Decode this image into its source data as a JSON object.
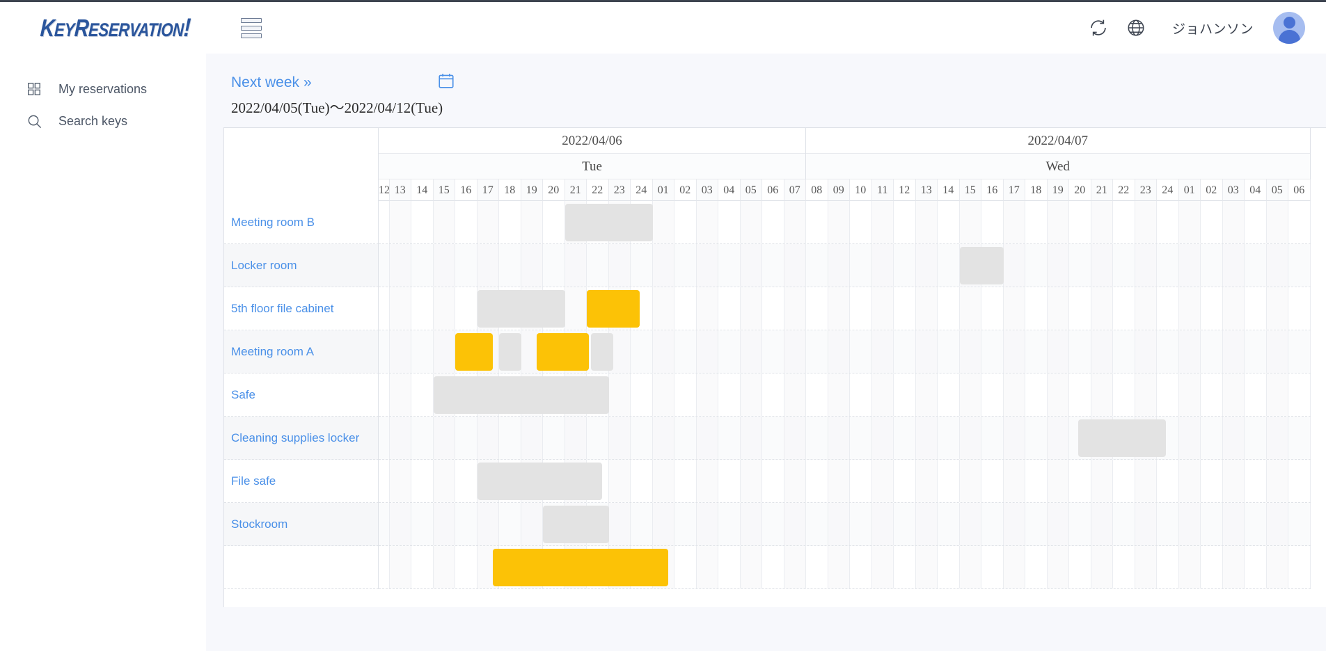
{
  "app": {
    "logo_prefix": "K",
    "logo_word1": "EY",
    "logo_r": "R",
    "logo_word2": "ESERVATION",
    "logo_bang": "!",
    "logo_full": "KeyReservation!",
    "accent_blue": "#4a90e8",
    "reserved_color": "#fcc206",
    "busy_color": "#e3e3e3"
  },
  "header": {
    "menu_icon": "hamburger-icon",
    "refresh_icon": "refresh-icon",
    "language_icon": "globe-icon",
    "user_name": "ジョハンソン",
    "avatar_icon": "user-avatar-icon"
  },
  "sidebar": {
    "items": [
      {
        "label": "My reservations",
        "icon": "grid-icon"
      },
      {
        "label": "Search keys",
        "icon": "search-icon"
      }
    ]
  },
  "toolbar": {
    "next_week_label": "Next week",
    "next_week_chevron": "»",
    "calendar_icon": "calendar-icon",
    "date_range": "2022/04/05(Tue)～2022/04/12(Tue)"
  },
  "schedule": {
    "days": [
      {
        "date": "2022/04/06",
        "dow": "Tue",
        "hours": [
          "12",
          "13",
          "14",
          "15",
          "16",
          "17",
          "18",
          "19",
          "20",
          "21",
          "22",
          "23",
          "24",
          "01",
          "02",
          "03",
          "04",
          "05",
          "06",
          "07"
        ],
        "first_hour_clipped": true
      },
      {
        "date": "2022/04/07",
        "dow": "Wed",
        "hours": [
          "08",
          "09",
          "10",
          "11",
          "12",
          "13",
          "14",
          "15",
          "16",
          "17",
          "18",
          "19",
          "20",
          "21",
          "22",
          "23",
          "24",
          "01",
          "02",
          "03",
          "04",
          "05",
          "06"
        ],
        "first_hour_clipped": false
      }
    ],
    "rows": [
      {
        "label": "Meeting room B",
        "blocks": [
          {
            "start": 9,
            "span": 4,
            "type": "gray"
          }
        ]
      },
      {
        "label": "Locker room",
        "blocks": [
          {
            "start": 27,
            "span": 2,
            "type": "gray"
          }
        ]
      },
      {
        "label": "5th floor file cabinet",
        "blocks": [
          {
            "start": 5,
            "span": 4,
            "type": "gray"
          },
          {
            "start": 10,
            "span": 2.4,
            "type": "yellow"
          }
        ]
      },
      {
        "label": "Meeting room A",
        "blocks": [
          {
            "start": 4,
            "span": 1.7,
            "type": "yellow"
          },
          {
            "start": 6,
            "span": 1,
            "type": "gray"
          },
          {
            "start": 7.7,
            "span": 2.4,
            "type": "yellow"
          },
          {
            "start": 10.2,
            "span": 1,
            "type": "gray"
          }
        ]
      },
      {
        "label": "Safe",
        "blocks": [
          {
            "start": 3,
            "span": 8,
            "type": "gray"
          }
        ]
      },
      {
        "label": "Cleaning supplies locker",
        "blocks": [
          {
            "start": 32.4,
            "span": 4,
            "type": "gray"
          }
        ]
      },
      {
        "label": "File safe",
        "blocks": [
          {
            "start": 5,
            "span": 5.7,
            "type": "gray"
          }
        ]
      },
      {
        "label": "Stockroom",
        "blocks": [
          {
            "start": 8,
            "span": 3,
            "type": "gray"
          }
        ]
      },
      {
        "label": "",
        "blocks": [
          {
            "start": 5.7,
            "span": 8,
            "type": "yellow"
          }
        ]
      }
    ]
  }
}
